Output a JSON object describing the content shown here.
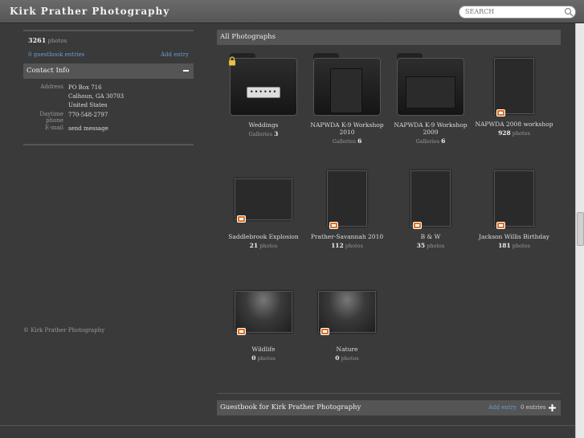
{
  "header": {
    "site_title": "Kirk Prather Photography",
    "search_placeholder": "SEARCH"
  },
  "sidebar": {
    "photo_count": "3261",
    "photo_label": "photos",
    "guestbook_count": "0",
    "guestbook_label": "guestbook entries",
    "add_entry": "Add entry",
    "contact_title": "Contact Info",
    "contact": {
      "address_label": "Address",
      "address_lines": [
        "PO Box 716",
        "Calhoun, GA 30703",
        "United States"
      ],
      "phone_label": "Daytime phone",
      "phone": "770-548-2797",
      "email_label": "E-mail",
      "email_link": "send message"
    },
    "copyright": "© Kirk Prather Photography"
  },
  "main": {
    "section_title": "All Photographs",
    "galleries": [
      {
        "name": "Weddings",
        "sub_label": "Galleries",
        "count": "3"
      },
      {
        "name": "NAPWDA K-9 Workshop 2010",
        "sub_label": "Galleries",
        "count": "6"
      },
      {
        "name": "NAPWDA K-9 Workshop 2009",
        "sub_label": "Galleries",
        "count": "6"
      },
      {
        "name": "NAPWDA 2008 workshop",
        "sub_label": "photos",
        "count": "928"
      },
      {
        "name": "Saddlebrook Explosion",
        "sub_label": "photos",
        "count": "21"
      },
      {
        "name": "Prather-Savannah 2010",
        "sub_label": "photos",
        "count": "112"
      },
      {
        "name": "B & W",
        "sub_label": "photos",
        "count": "35"
      },
      {
        "name": "Jackson Willis Birthday",
        "sub_label": "photos",
        "count": "181"
      },
      {
        "name": "Wildlife",
        "sub_label": "photos",
        "count": "0"
      },
      {
        "name": "Nature",
        "sub_label": "photos",
        "count": "0"
      }
    ],
    "password_mask": "••••••"
  },
  "guestbook": {
    "title": "Guestbook for Kirk Prather Photography",
    "add_entry": "Add entry",
    "entries": "0 entries"
  },
  "colors": {
    "link": "#6a9ad2",
    "badge": "#e07020",
    "background": "#3a3a3a"
  }
}
